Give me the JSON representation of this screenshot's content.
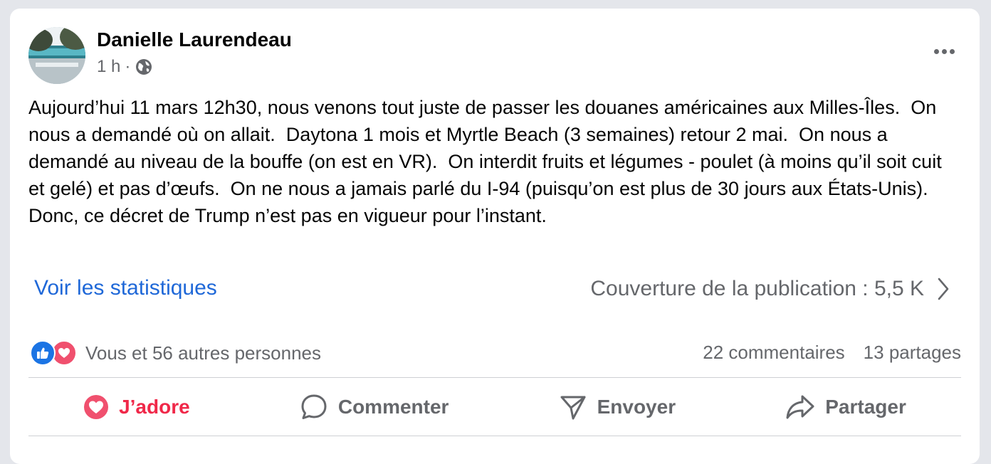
{
  "post": {
    "author": "Danielle Laurendeau",
    "time": "1 h",
    "separator": "·",
    "audience_icon": "globe-icon",
    "text": "Aujourd’hui 11 mars 12h30, nous venons tout juste de passer les douanes américaines aux Milles-Îles.  On nous a demandé où on allait.  Daytona 1 mois et Myrtle Beach (3 semaines) retour 2 mai.  On nous a demandé au niveau de la bouffe (on est en VR).  On interdit fruits et légumes - poulet (à moins qu’il soit cuit et gelé) et pas d’œufs.  On ne nous a jamais parlé du I-94 (puisqu’on est plus de 30 jours aux États-Unis).  Donc, ce décret de Trump n’est pas en vigueur pour l’instant."
  },
  "insights": {
    "link_label": "Voir les statistiques",
    "reach_label": "Couverture de la publication : 5,5 K"
  },
  "engagement": {
    "reactions_text": "Vous et 56 autres personnes",
    "comments": "22 commentaires",
    "shares": "13 partages"
  },
  "actions": {
    "love": "J’adore",
    "comment": "Commenter",
    "send": "Envoyer",
    "share": "Partager"
  },
  "colors": {
    "link_blue": "#1f68d8",
    "love_red": "#f02849",
    "like_blue": "#1b74e4",
    "secondary_text": "#65676b"
  }
}
